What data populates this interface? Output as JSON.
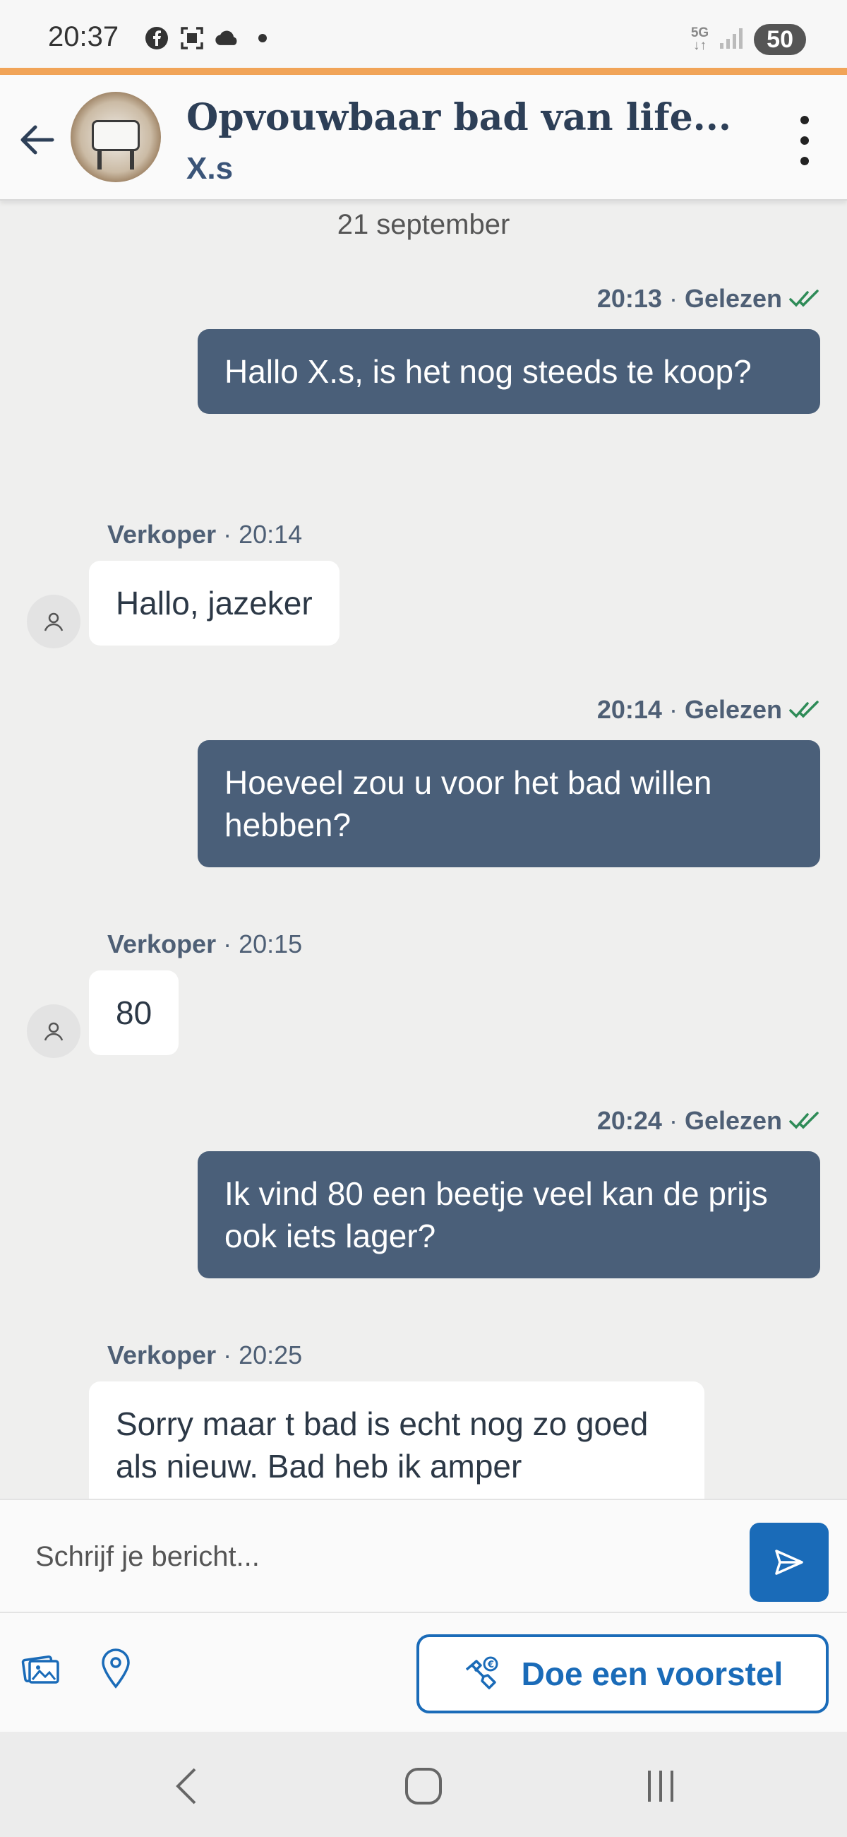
{
  "status_bar": {
    "time": "20:37",
    "network": "5G",
    "battery": "50",
    "icons": [
      "facebook-icon",
      "scan-icon",
      "cloud-icon",
      "dot-icon",
      "signal-icon"
    ]
  },
  "header": {
    "title": "Opvouwbaar bad van life...",
    "subtitle": "X.s"
  },
  "chat": {
    "date_separator": "21 september",
    "messages": [
      {
        "direction": "out",
        "time": "20:13",
        "status": "Gelezen",
        "text": "Hallo X.s, is het nog steeds te koop?"
      },
      {
        "direction": "in",
        "sender": "Verkoper",
        "time": "20:14",
        "text": "Hallo, jazeker"
      },
      {
        "direction": "out",
        "time": "20:14",
        "status": "Gelezen",
        "text": "Hoeveel zou u voor het bad willen hebben?"
      },
      {
        "direction": "in",
        "sender": "Verkoper",
        "time": "20:15",
        "text": "80"
      },
      {
        "direction": "out",
        "time": "20:24",
        "status": "Gelezen",
        "text": "Ik vind 80 een beetje veel kan de prijs ook iets lager?"
      },
      {
        "direction": "in",
        "sender": "Verkoper",
        "time": "20:25",
        "text": "Sorry maar t bad is echt nog zo goed als nieuw. Bad heb ik amper"
      }
    ]
  },
  "composer": {
    "placeholder": "Schrijf je bericht...",
    "offer_label": "Doe een voorstel"
  },
  "colors": {
    "accent": "#1a6bb8",
    "outgoing_bubble": "#4a5f79",
    "orange_line": "#f1a458",
    "read_check": "#2e8b57"
  }
}
